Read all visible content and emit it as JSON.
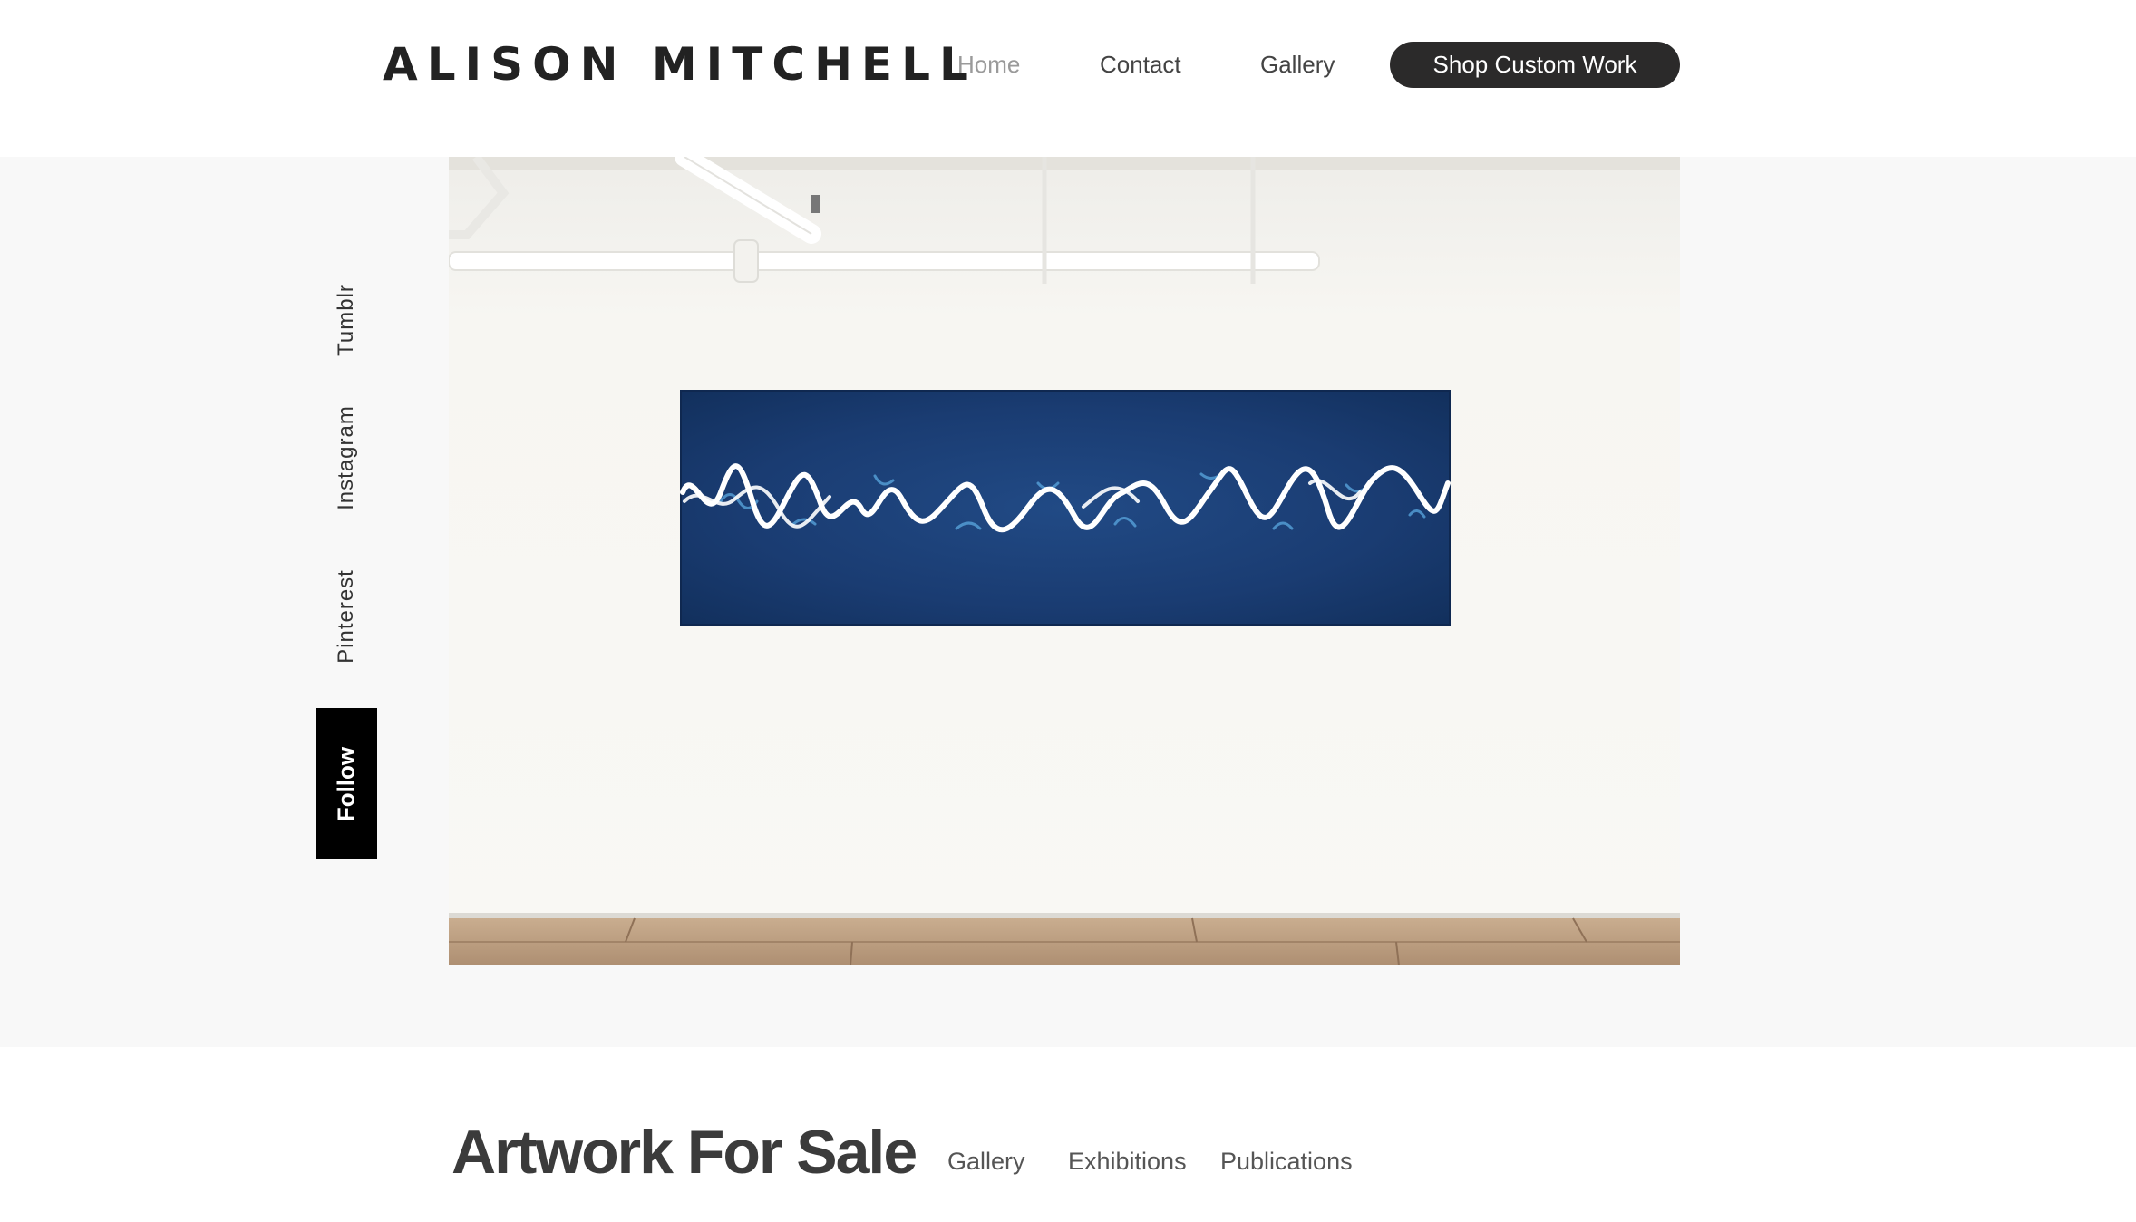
{
  "header": {
    "logo": "ALISON MITCHELL",
    "nav": [
      {
        "label": "Home",
        "active": true
      },
      {
        "label": "Contact",
        "active": false
      },
      {
        "label": "Gallery",
        "active": false
      }
    ],
    "cta_label": "Shop Custom Work"
  },
  "social": {
    "links": [
      "Tumblr",
      "Instagram",
      "Pinterest"
    ],
    "follow_label": "Follow"
  },
  "hero": {
    "image_subject": "blue abstract painting with white squiggle line hanging on a white gallery wall",
    "colors": {
      "painting": "#1d3f74",
      "wall": "#f6f5f1",
      "floor": "#b9997b"
    }
  },
  "section": {
    "title": "Artwork For Sale",
    "links": [
      "Gallery",
      "Exhibitions",
      "Publications"
    ]
  },
  "colors": {
    "button_bg": "#2b2a2a",
    "band_bg": "#f8f8f8",
    "follow_bg": "#000000"
  }
}
